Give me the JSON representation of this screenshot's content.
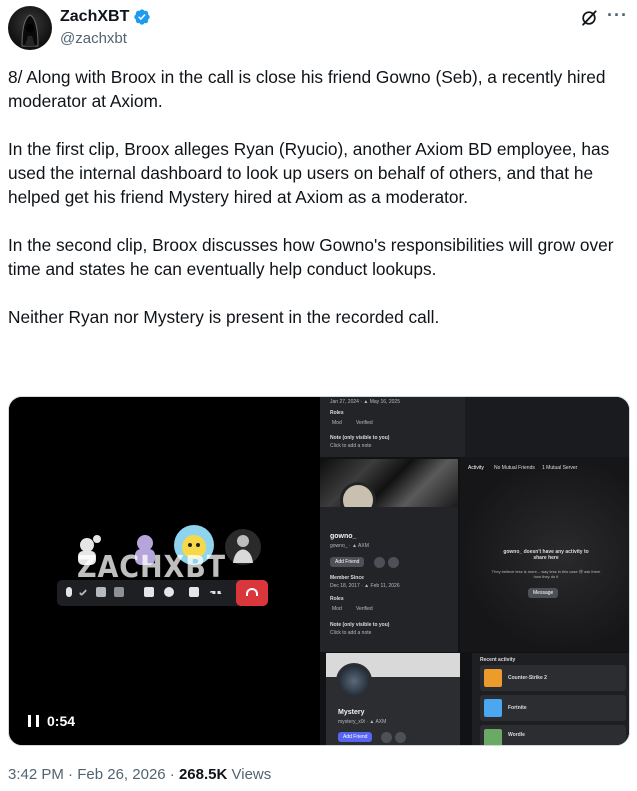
{
  "author": {
    "display_name": "ZachXBT",
    "handle": "@zachxbt",
    "verified": true,
    "avatar_icon": "hooded-figure-avatar"
  },
  "header_actions": {
    "grok_icon": "grok-icon",
    "more_icon": "more-icon"
  },
  "tweet": {
    "paragraphs": [
      "8/ Along with Broox in the call is close his friend Gowno (Seb), a recently hired moderator at Axiom.",
      "In the first clip, Broox alleges Ryan (Ryucio), another Axiom BD employee, has used the internal dashboard to look up users on behalf of others, and that he helped get his friend Mystery hired at Axiom as a moderator.",
      "In the second clip, Broox discusses how Gowno's responsibilities will grow over time and states he can eventually help conduct lookups.",
      "Neither Ryan nor Mystery is present in the recorded call."
    ]
  },
  "video": {
    "watermark": "ZACHXBT",
    "duration": "0:54",
    "pause_icon": "pause-icon"
  },
  "screenshot": {
    "top_profile": {
      "dates": "Jan 27, 2024 · ▲ May 16, 2025",
      "roles_label": "Roles",
      "roles": [
        "Mod",
        "Verified"
      ],
      "note_label": "Note (only visible to you)",
      "note_placeholder": "Click to add a note"
    },
    "gowno_profile": {
      "name": "gowno_",
      "tag": "gowno_ · ▲ AXM",
      "add_friend": "Add Friend",
      "member_since_label": "Member Since",
      "member_since": "Dec 18, 2017 · ▲ Feb 11, 2026",
      "roles_label": "Roles",
      "roles": [
        "Mod",
        "Verified"
      ],
      "note_label": "Note (only visible to you)",
      "note_placeholder": "Click to add a note"
    },
    "activity_panel": {
      "tabs": [
        "Activity",
        "No Mutual Friends",
        "1 Mutual Server"
      ],
      "empty_title": "gowno_ doesn't have any activity to share here",
      "empty_sub": "They believe less is more... way less in this case 😅 ask them how they do it",
      "message_button": "Message"
    },
    "mystery_profile": {
      "name": "Mystery",
      "tag": "mystery_x0t · ▲ AXM",
      "add_friend": "Add Friend"
    },
    "recent_activity": {
      "label": "Recent activity",
      "games": [
        "Counter-Strike 2",
        "Fortnite",
        "Wordle"
      ]
    }
  },
  "footer": {
    "time": "3:42 PM",
    "date": "Feb 26, 2026",
    "views_count": "268.5K",
    "views_label": "Views"
  },
  "colors": {
    "text": "#0f1419",
    "secondary": "#536471",
    "verified": "#1d9bf0",
    "hangup": "#da373c",
    "discord_blurple": "#5865f2"
  }
}
